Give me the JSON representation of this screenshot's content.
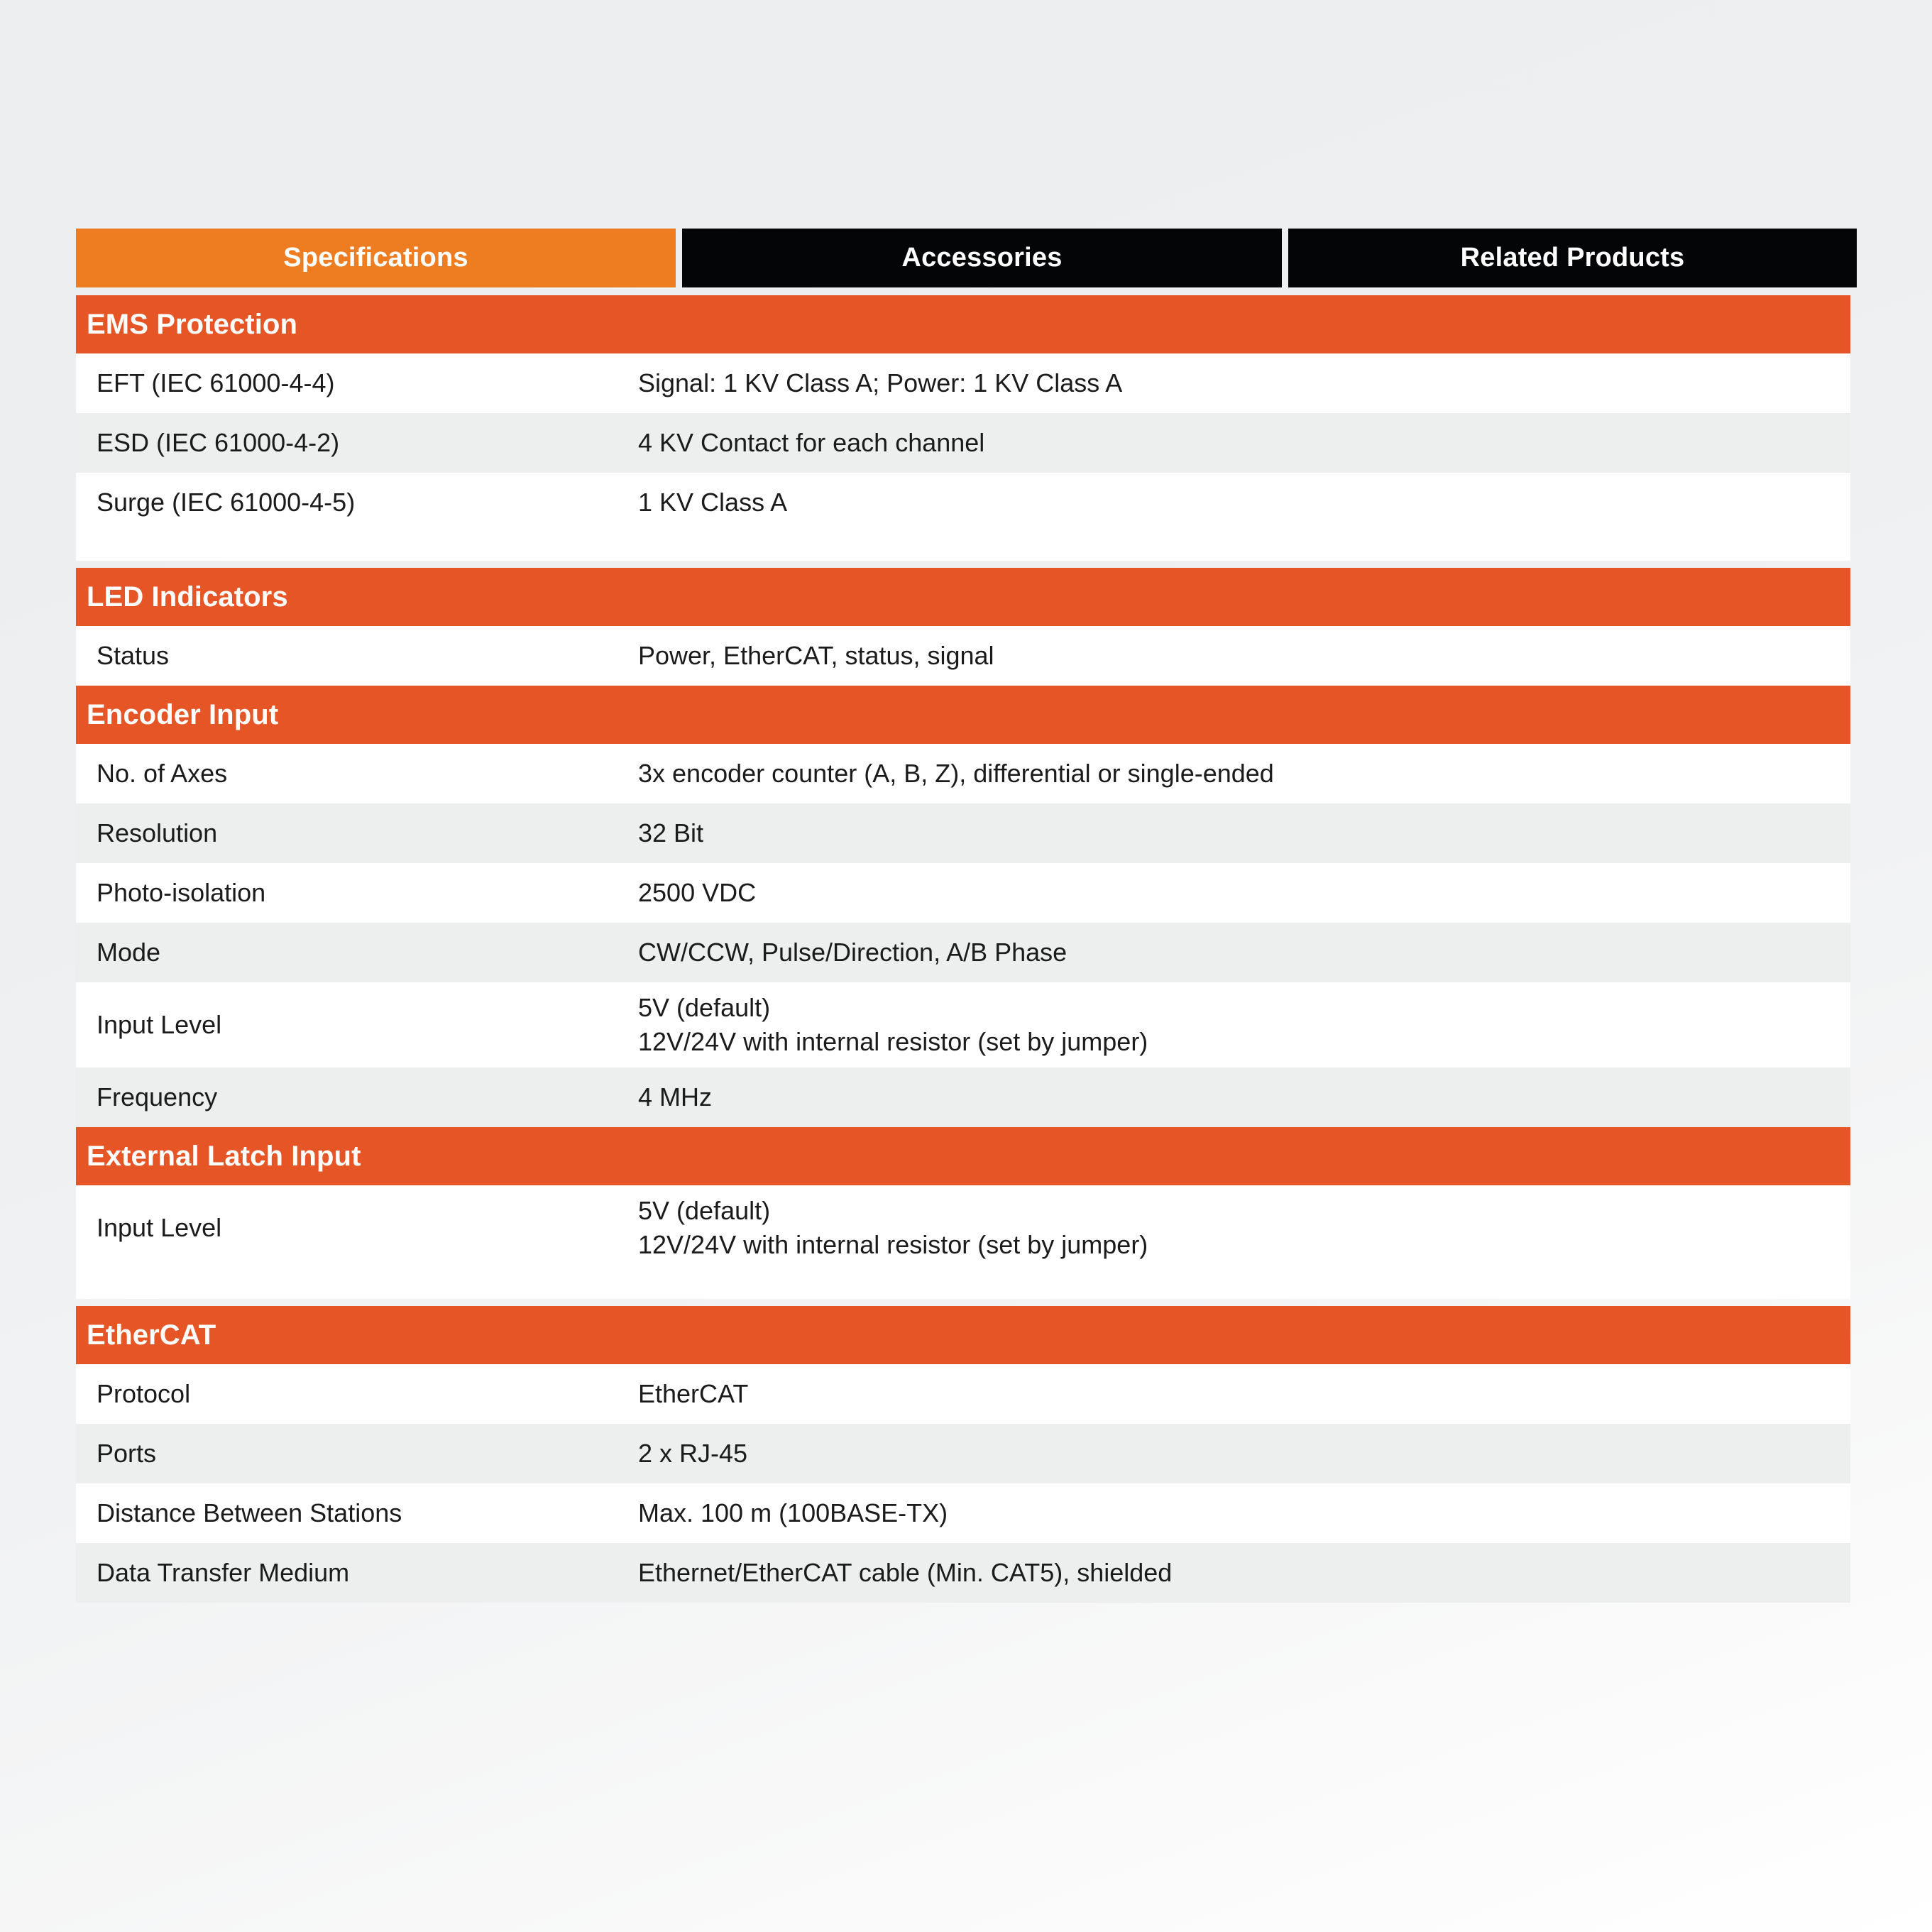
{
  "tabs": [
    {
      "label": "Specifications",
      "active": true
    },
    {
      "label": "Accessories",
      "active": false
    },
    {
      "label": "Related Products",
      "active": false
    }
  ],
  "colors": {
    "tab_active": "#EE7D21",
    "tab_inactive": "#030507",
    "section_header": "#E65525",
    "row_odd": "#FFFFFF",
    "row_even": "#EDEEEE",
    "text": "#1B1B1B",
    "page_background": "#ECEEF0"
  },
  "sections": [
    {
      "title": "EMS Protection",
      "rows": [
        {
          "label": "EFT (IEC 61000-4-4)",
          "value": "Signal: 1 KV Class A; Power: 1 KV Class A"
        },
        {
          "label": "ESD (IEC 61000-4-2)",
          "value": "4 KV Contact for each channel"
        },
        {
          "label": "Surge (IEC 61000-4-5)",
          "value": "1 KV Class A"
        }
      ]
    },
    {
      "title": "LED Indicators",
      "rows": [
        {
          "label": "Status",
          "value": "Power, EtherCAT, status, signal"
        }
      ]
    },
    {
      "title": "Encoder Input",
      "rows": [
        {
          "label": "No. of Axes",
          "value": "3x encoder counter (A, B, Z), differential or single-ended"
        },
        {
          "label": "Resolution",
          "value": "32 Bit"
        },
        {
          "label": "Photo-isolation",
          "value": "2500 VDC"
        },
        {
          "label": "Mode",
          "value": "CW/CCW, Pulse/Direction, A/B Phase"
        },
        {
          "label": "Input Level",
          "value": "5V (default)\n12V/24V with internal resistor (set by jumper)"
        },
        {
          "label": "Frequency",
          "value": "4 MHz"
        }
      ]
    },
    {
      "title": "External Latch Input",
      "rows": [
        {
          "label": "Input Level",
          "value": "5V (default)\n12V/24V with internal resistor (set by jumper)"
        }
      ]
    },
    {
      "title": "EtherCAT",
      "rows": [
        {
          "label": "Protocol",
          "value": "EtherCAT"
        },
        {
          "label": "Ports",
          "value": "2 x RJ-45"
        },
        {
          "label": "Distance Between Stations",
          "value": "Max. 100 m (100BASE-TX)"
        },
        {
          "label": "Data Transfer Medium",
          "value": "Ethernet/EtherCAT cable (Min. CAT5), shielded"
        }
      ]
    }
  ]
}
